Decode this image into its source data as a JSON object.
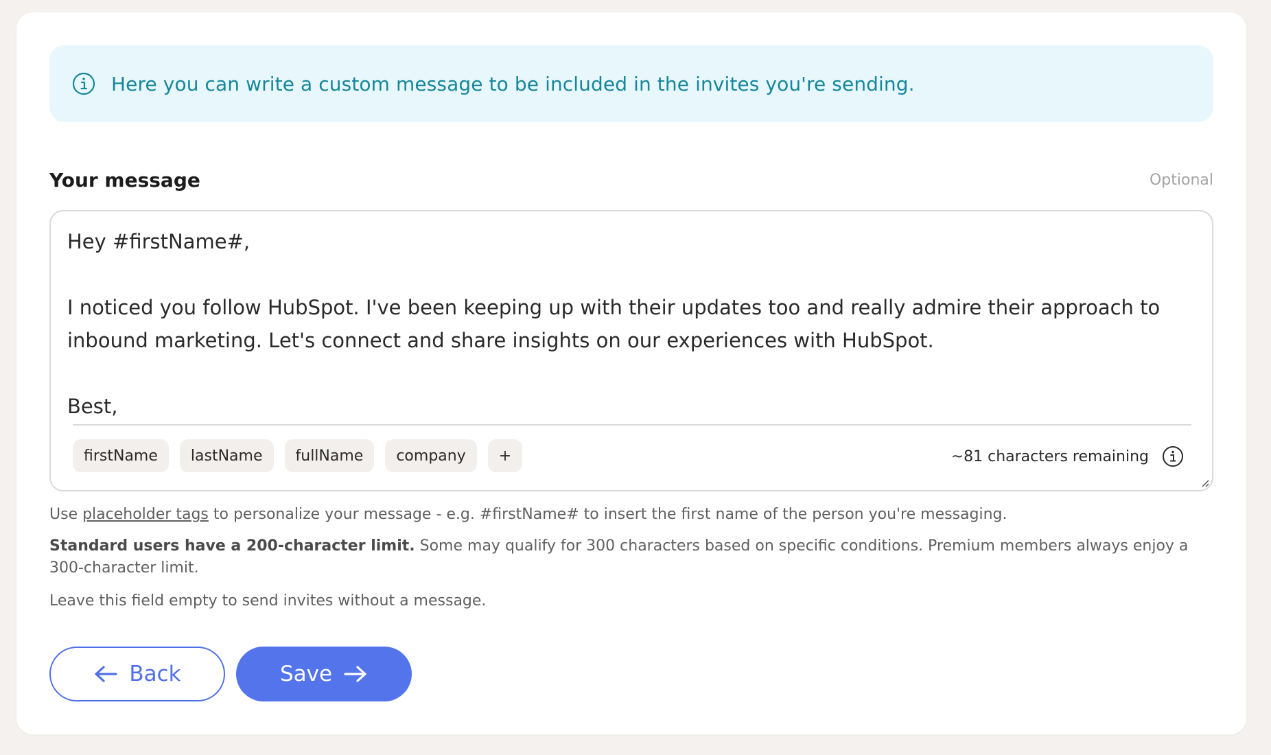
{
  "banner": {
    "icon": "info-icon",
    "text": "Here you can write a custom message to be included in the invites you're sending."
  },
  "field": {
    "label": "Your message",
    "optional": "Optional",
    "value": "Hey #firstName#,\n\nI noticed you follow HubSpot. I've been keeping up with their updates too and really admire their approach to inbound marketing. Let's connect and share insights on our experiences with HubSpot.\n\nBest,",
    "tags": [
      "firstName",
      "lastName",
      "fullName",
      "company",
      "+"
    ],
    "remaining": "~81 characters remaining"
  },
  "help": {
    "line1_prefix": "Use ",
    "line1_link": "placeholder tags",
    "line1_suffix": " to personalize your message - e.g. #firstName# to insert the first name of the person you're messaging.",
    "line2_bold": "Standard users have a 200-character limit.",
    "line2_rest": " Some may qualify for 300 characters based on specific conditions. Premium members always enjoy a 300-character limit.",
    "line3": "Leave this field empty to send invites without a message."
  },
  "buttons": {
    "back": "Back",
    "save": "Save"
  },
  "colors": {
    "accent": "#5374ea",
    "info_text": "#15879a",
    "info_bg": "#e8f7fc"
  }
}
